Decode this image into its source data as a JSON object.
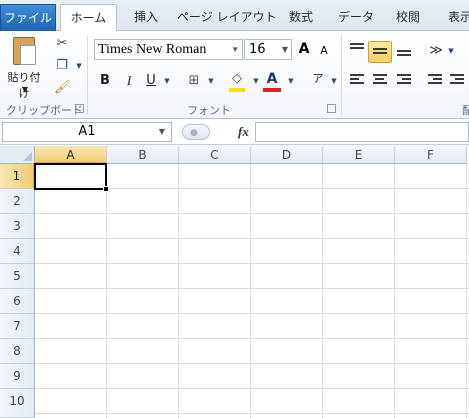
{
  "tabs": {
    "file": "ファイル",
    "home": "ホーム",
    "insert": "挿入",
    "page_layout": "ページ レイアウト",
    "formulas": "数式",
    "data": "データ",
    "review": "校閲",
    "view": "表示"
  },
  "ribbon": {
    "clipboard": {
      "paste_label": "貼り付け",
      "group_label": "クリップボード"
    },
    "font": {
      "group_label": "フォント",
      "font_name": "Times New Roman",
      "font_size": "16",
      "bold": "B",
      "italic": "I",
      "underline": "U",
      "grow": "A",
      "shrink": "A",
      "font_color_letter": "A",
      "highlight_color": "#f7e000",
      "font_color": "#e02020"
    },
    "alignment": {
      "group_label": "配"
    }
  },
  "formula_bar": {
    "namebox": "A1",
    "fx": "fx",
    "content": ""
  },
  "grid": {
    "columns": [
      "A",
      "B",
      "C",
      "D",
      "E",
      "F"
    ],
    "rows": [
      "1",
      "2",
      "3",
      "4",
      "5",
      "6",
      "7",
      "8",
      "9",
      "10"
    ],
    "selected_column": "A",
    "selected_row": "1"
  }
}
